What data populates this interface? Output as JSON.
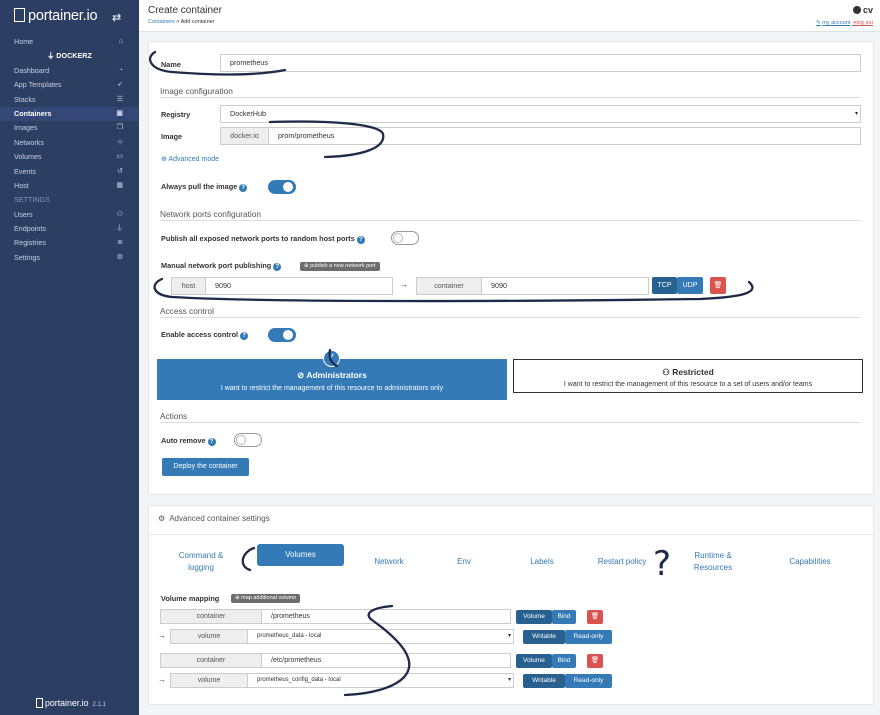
{
  "sidebar": {
    "logo": "portainer.io",
    "endpoint": "DOCKERZ",
    "items": [
      {
        "label": "Home",
        "icon": "home-icon",
        "glyph": "⌂"
      },
      {
        "label": "Dashboard",
        "icon": "dashboard-icon",
        "glyph": "◔"
      },
      {
        "label": "App Templates",
        "icon": "rocket-icon",
        "glyph": "➶"
      },
      {
        "label": "Stacks",
        "icon": "list-icon",
        "glyph": "☰"
      },
      {
        "label": "Containers",
        "icon": "cubes-icon",
        "glyph": "▣"
      },
      {
        "label": "Images",
        "icon": "clone-icon",
        "glyph": "❐"
      },
      {
        "label": "Networks",
        "icon": "sitemap-icon",
        "glyph": "⊹"
      },
      {
        "label": "Volumes",
        "icon": "hdd-icon",
        "glyph": "▭"
      },
      {
        "label": "Events",
        "icon": "history-icon",
        "glyph": "↺"
      },
      {
        "label": "Host",
        "icon": "th-icon",
        "glyph": "▦"
      }
    ],
    "settings_header": "SETTINGS",
    "settings_items": [
      {
        "label": "Users",
        "icon": "users-icon",
        "glyph": "⚇"
      },
      {
        "label": "Endpoints",
        "icon": "plug-icon",
        "glyph": "⏚"
      },
      {
        "label": "Registries",
        "icon": "database-icon",
        "glyph": "≣"
      },
      {
        "label": "Settings",
        "icon": "cogs-icon",
        "glyph": "⚙"
      }
    ],
    "footer_logo": "portainer.io",
    "version": "2.1.1"
  },
  "header": {
    "title": "Create container",
    "crumb_link": "Containers",
    "crumb_rest": " > Add container",
    "user": "cv",
    "my_account": "my account",
    "log_out": "log out"
  },
  "form": {
    "name_label": "Name",
    "name_value": "prometheus",
    "image_config_title": "Image configuration",
    "registry_label": "Registry",
    "registry_value": "DockerHub",
    "image_label": "Image",
    "image_prefix": "docker.io",
    "image_value": "prom/prometheus",
    "advanced_mode": "Advanced mode",
    "always_pull_label": "Always pull the image",
    "always_pull_on": true,
    "network_ports_title": "Network ports configuration",
    "publish_all_label": "Publish all exposed network ports to random host ports",
    "publish_all_on": false,
    "manual_ports_label": "Manual network port publishing",
    "publish_new_port": "publish a new network port",
    "port_host_addon": "host",
    "port_host_value": "9090",
    "port_arrow": "→",
    "port_container_addon": "container",
    "port_container_value": "9090",
    "tcp": "TCP",
    "udp": "UDP",
    "access_control_title": "Access control",
    "enable_access_label": "Enable access control",
    "enable_access_on": true,
    "admins_title": "Administrators",
    "admins_desc": "I want to restrict the management of this resource to administrators only",
    "restricted_title": "Restricted",
    "restricted_desc": "I want to restrict the management of this resource to a set of users and/or teams",
    "actions_title": "Actions",
    "auto_remove_label": "Auto remove",
    "auto_remove_on": false,
    "deploy_button": "Deploy the container"
  },
  "advanced": {
    "title": "Advanced container settings",
    "tabs": [
      {
        "label": "Command &\nlogging",
        "active": false
      },
      {
        "label": "Volumes",
        "active": true
      },
      {
        "label": "Network",
        "active": false
      },
      {
        "label": "Env",
        "active": false
      },
      {
        "label": "Labels",
        "active": false
      },
      {
        "label": "Restart policy",
        "active": false
      },
      {
        "label": "Runtime &\nResources",
        "active": false
      },
      {
        "label": "Capabilities",
        "active": false
      }
    ],
    "volume_mapping_label": "Volume mapping",
    "map_additional": "map additional volume",
    "volumes": [
      {
        "container_addon": "container",
        "container_path": "/prometheus",
        "volume_addon": "volume",
        "volume_value": "prometheus_data - local"
      },
      {
        "container_addon": "container",
        "container_path": "/etc/prometheus",
        "volume_addon": "volume",
        "volume_value": "prometheus_config_data - local"
      }
    ],
    "volume_btn": "Volume",
    "bind_btn": "Bind",
    "writable_btn": "Writable",
    "readonly_btn": "Read-only"
  },
  "annotation": {
    "question_mark": "?"
  },
  "colors": {
    "sidebar": "#2d3e63",
    "primary": "#337ab7",
    "danger": "#d9534f",
    "annotation": "#1e2a4a"
  }
}
